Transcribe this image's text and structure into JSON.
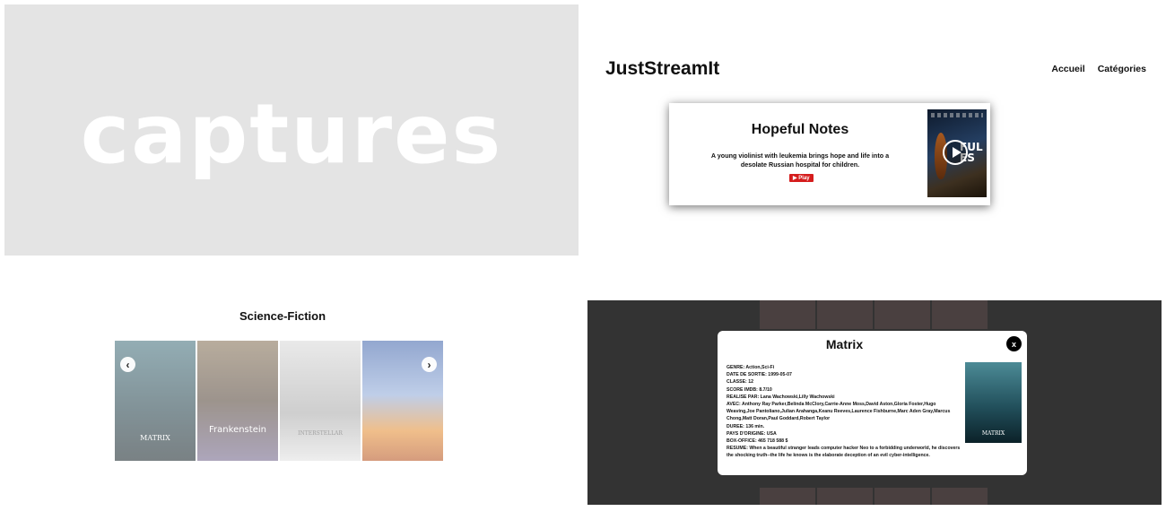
{
  "captures": {
    "word": "captures"
  },
  "site": {
    "logo": "JustStreamIt",
    "nav": [
      {
        "label": "Accueil"
      },
      {
        "label": "Catégories"
      }
    ]
  },
  "hero": {
    "title": "Hopeful Notes",
    "description": "A young violinist with leukemia brings hope and life into a desolate Russian hospital for children.",
    "play_label": "▶ Play",
    "poster_text": "FUL\nES"
  },
  "category": {
    "title": "Science-Fiction",
    "posters": [
      {
        "caption": "MATRIX"
      },
      {
        "caption": "Frankenstein"
      },
      {
        "caption": "INTERSTELLAR"
      },
      {
        "caption": ""
      }
    ],
    "prev_icon": "‹",
    "next_icon": "›"
  },
  "modal": {
    "title": "Matrix",
    "close_label": "x",
    "poster_caption": "MATRIX",
    "details": [
      "GENRE: Action,Sci-Fi",
      "DATE DE SORTIE: 1999-05-07",
      "CLASSE: 12",
      "SCORE IMDB: 8.7/10",
      "REALISE PAR: Lana Wachowski,Lilly Wachowski",
      "AVEC: Anthony Ray Parker,Belinda McClory,Carrie-Anne Moss,David Aston,Gloria Foster,Hugo Weaving,Joe Pantoliano,Julian Arahanga,Keanu Reeves,Laurence Fishburne,Marc Aden Gray,Marcus Chong,Matt Doran,Paul Goddard,Robert Taylor",
      "DUREE: 136 min.",
      "PAYS D'ORIGINE: USA",
      "BOX-OFFICE: 465 718 588 $",
      "RESUME: When a beautiful stranger leads computer hacker Neo to a forbidding underworld, he discovers the shocking truth--the life he knows is the elaborate deception of an evil cyber-intelligence."
    ]
  },
  "icons": {
    "play": "play-icon",
    "prev": "chevron-left-icon",
    "next": "chevron-right-icon",
    "close": "close-icon"
  },
  "colors": {
    "play_button": "#d51d1d",
    "modal_backdrop": "#333333",
    "captures_background": "#e4e4e4"
  }
}
